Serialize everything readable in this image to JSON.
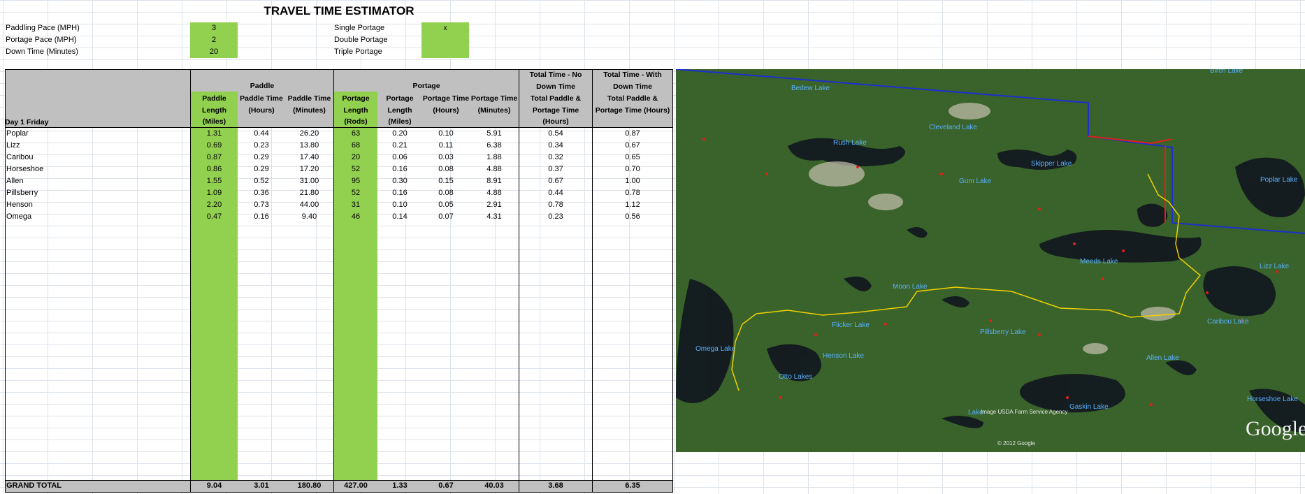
{
  "sheet_title": "TRAVEL TIME ESTIMATOR",
  "params": [
    {
      "label": "Paddling Pace (MPH)",
      "value": "3"
    },
    {
      "label": "Portage Pace (MPH)",
      "value": "2"
    },
    {
      "label": "Down Time (Minutes)",
      "value": "20"
    }
  ],
  "options": [
    {
      "label": "Single Portage",
      "value": "x"
    },
    {
      "label": "Double Portage",
      "value": ""
    },
    {
      "label": "Triple Portage",
      "value": ""
    }
  ],
  "headers": {
    "day_label": "Day 1 Friday",
    "group_paddle": "Paddle",
    "group_portage": "Portage",
    "total_no_down": "Total Time - No Down Time",
    "total_with_down": "Total Time - With Down Time",
    "cols": [
      "Paddle Length (Miles)",
      "Paddle Time (Hours)",
      "Paddle Time (Minutes)",
      "Portage Length (Rods)",
      "Portage Length (Miles)",
      "Portage Time (Hours)",
      "Portage Time (Minutes)",
      "Total Paddle & Portage Time (Hours)",
      "Total Paddle & Portage Time (Hours)"
    ]
  },
  "rows": [
    {
      "name": "Poplar",
      "vals": [
        "1.31",
        "0.44",
        "26.20",
        "63",
        "0.20",
        "0.10",
        "5.91",
        "0.54",
        "0.87"
      ]
    },
    {
      "name": "Lizz",
      "vals": [
        "0.69",
        "0.23",
        "13.80",
        "68",
        "0.21",
        "0.11",
        "6.38",
        "0.34",
        "0.67"
      ]
    },
    {
      "name": "Caribou",
      "vals": [
        "0.87",
        "0.29",
        "17.40",
        "20",
        "0.06",
        "0.03",
        "1.88",
        "0.32",
        "0.65"
      ]
    },
    {
      "name": "Horseshoe",
      "vals": [
        "0.86",
        "0.29",
        "17.20",
        "52",
        "0.16",
        "0.08",
        "4.88",
        "0.37",
        "0.70"
      ]
    },
    {
      "name": "Allen",
      "vals": [
        "1.55",
        "0.52",
        "31.00",
        "95",
        "0.30",
        "0.15",
        "8.91",
        "0.67",
        "1.00"
      ]
    },
    {
      "name": "Pillsberry",
      "vals": [
        "1.09",
        "0.36",
        "21.80",
        "52",
        "0.16",
        "0.08",
        "4.88",
        "0.44",
        "0.78"
      ]
    },
    {
      "name": "Henson",
      "vals": [
        "2.20",
        "0.73",
        "44.00",
        "31",
        "0.10",
        "0.05",
        "2.91",
        "0.78",
        "1.12"
      ]
    },
    {
      "name": "Omega",
      "vals": [
        "0.47",
        "0.16",
        "9.40",
        "46",
        "0.14",
        "0.07",
        "4.31",
        "0.23",
        "0.56"
      ]
    }
  ],
  "grand_total": {
    "label": "GRAND TOTAL",
    "vals": [
      "9.04",
      "3.01",
      "180.80",
      "427.00",
      "1.33",
      "0.67",
      "40.03",
      "3.68",
      "6.35"
    ]
  },
  "map": {
    "brand": "Google",
    "copyright": "© 2012 Google",
    "credit": "Image USDA Farm Service Agency",
    "lakes": [
      "Birch Lake",
      "Bedew Lake",
      "Rush Lake",
      "Cleveland Lake",
      "Skipper Lake",
      "Gum Lake",
      "Poplar Lake",
      "Lizz Lake",
      "Meeds Lake",
      "Moon Lake",
      "Caribou Lake",
      "Flicker Lake",
      "Pillsberry Lake",
      "Omega Lake",
      "Henson Lake",
      "Allen Lake",
      "Otto Lakes",
      "Gaskin Lake",
      "Horseshoe Lake",
      "Lake"
    ]
  },
  "colors": {
    "input_green": "#92d050",
    "header_grey": "#c0c0c0",
    "route": "#f2d000",
    "boundary": "#1e2fd0",
    "portage": "#e0201a"
  }
}
